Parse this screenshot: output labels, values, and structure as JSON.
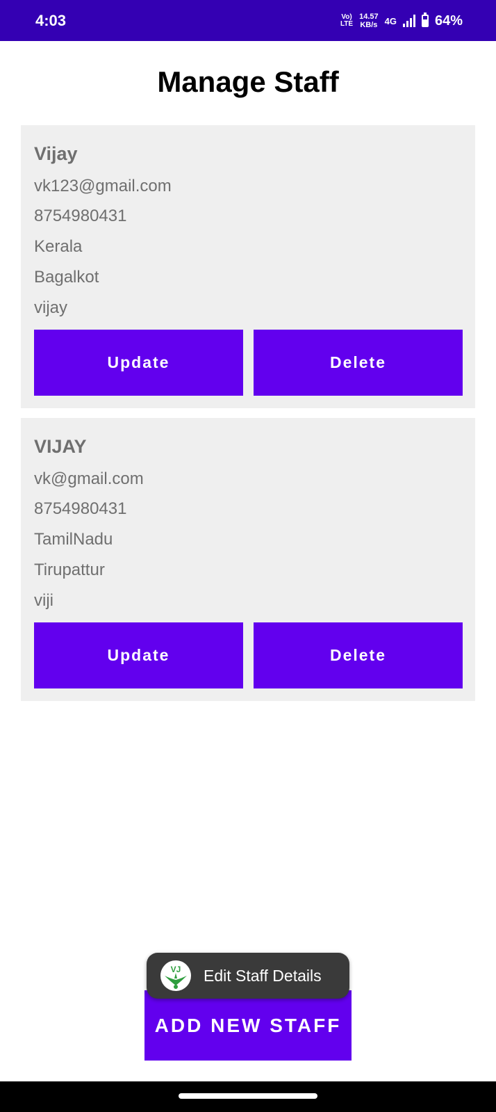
{
  "status_bar": {
    "time": "4:03",
    "volte_top": "Vo)",
    "volte_bottom": "LTE",
    "speed_value": "14.57",
    "speed_unit": "KB/s",
    "network": "4G",
    "battery": "64%",
    "battery_level": 0.64,
    "signal_icon": "signal-icon",
    "battery_icon": "battery-icon"
  },
  "page": {
    "title": "Manage Staff"
  },
  "staff": [
    {
      "name": "Vijay",
      "email": "vk123@gmail.com",
      "phone": "8754980431",
      "state": "Kerala",
      "city": "Bagalkot",
      "username": "vijay",
      "update_label": "Update",
      "delete_label": "Delete"
    },
    {
      "name": "VIJAY",
      "email": "vk@gmail.com",
      "phone": "8754980431",
      "state": "TamilNadu",
      "city": "Tirupattur",
      "username": "viji",
      "update_label": "Update",
      "delete_label": "Delete"
    }
  ],
  "toast": {
    "icon": "app-logo-icon",
    "icon_text": "VJ",
    "text": "Edit Staff Details"
  },
  "add_button": {
    "label": "ADD NEW STAFF"
  },
  "colors": {
    "status_bar": "#3400b3",
    "primary": "#6200ee",
    "card_bg": "#efefef",
    "toast_bg": "#3a3a3a"
  }
}
